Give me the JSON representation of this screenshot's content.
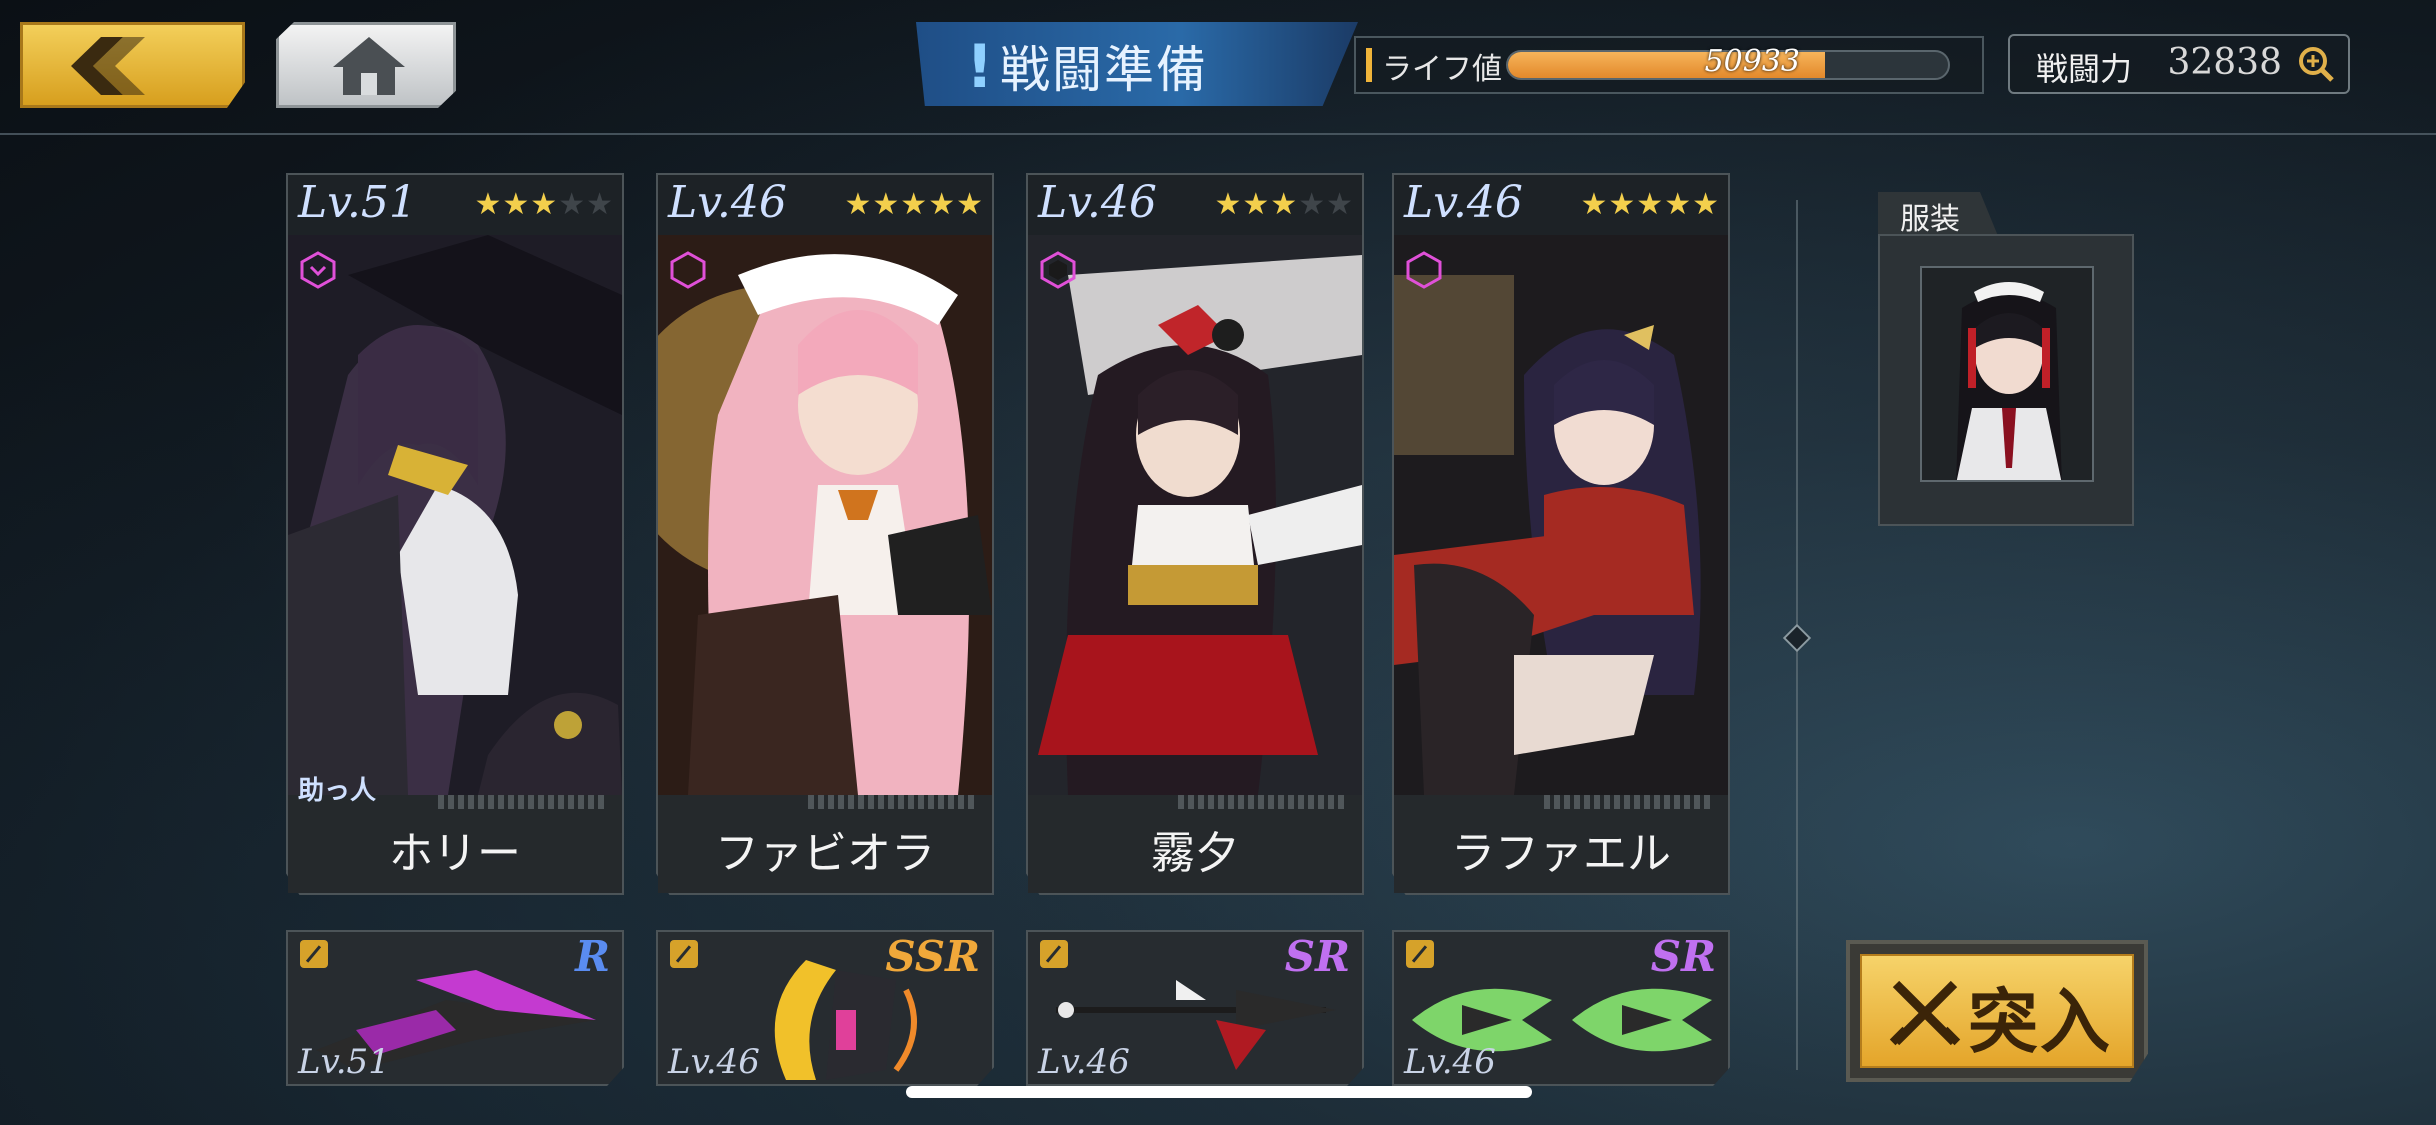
{
  "header": {
    "title": "戦闘準備",
    "title_mark": "!",
    "life_label": "ライフ値",
    "life_value": "50933",
    "life_fill_fraction": 0.72,
    "power_label": "戦闘力",
    "power_value": "32838"
  },
  "characters": [
    {
      "level": "Lv.51",
      "stars": 3,
      "name": "ホリー",
      "helper": "助っ人",
      "accent": "#e050d8"
    },
    {
      "level": "Lv.46",
      "stars": 5,
      "name": "ファビオラ",
      "helper": "",
      "accent": "#e050d8"
    },
    {
      "level": "Lv.46",
      "stars": 3,
      "name": "霧夕",
      "helper": "",
      "accent": "#e050d8"
    },
    {
      "level": "Lv.46",
      "stars": 5,
      "name": "ラファエル",
      "helper": "",
      "accent": "#e050d8"
    }
  ],
  "weapons": [
    {
      "rarity": "R",
      "level": "Lv.51",
      "rarity_color": "#5a8cf0",
      "icon": "scythe-blade"
    },
    {
      "rarity": "SSR",
      "level": "Lv.46",
      "rarity_color": "#f0a83a",
      "icon": "battle-axe"
    },
    {
      "rarity": "SR",
      "level": "Lv.46",
      "rarity_color": "#c070f0",
      "icon": "spear"
    },
    {
      "rarity": "SR",
      "level": "Lv.46",
      "rarity_color": "#c070f0",
      "icon": "twin-blades"
    }
  ],
  "outfit": {
    "label": "服装"
  },
  "charge": {
    "label": "突入"
  },
  "icons": {
    "back": "back-arrow-icon",
    "home": "home-icon",
    "power_detail": "magnify-plus-icon"
  }
}
